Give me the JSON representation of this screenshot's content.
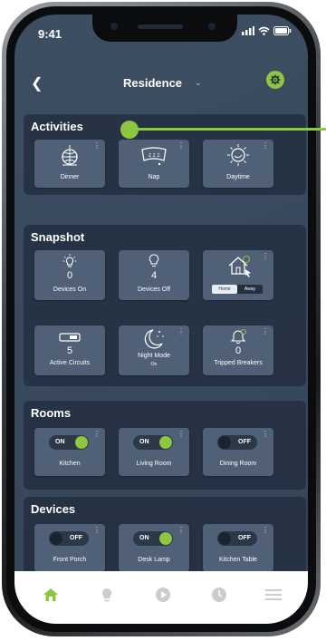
{
  "status": {
    "time": "9:41"
  },
  "header": {
    "title": "Residence"
  },
  "colors": {
    "accent": "#8dc63f",
    "card": "#4f6077",
    "section": "#232f40"
  },
  "activities": {
    "title": "Activities",
    "items": [
      {
        "label": "Dinner",
        "icon": "disco-ball-icon"
      },
      {
        "label": "Nap",
        "icon": "pillow-icon"
      },
      {
        "label": "Daytime",
        "icon": "sun-icon"
      }
    ]
  },
  "snapshot": {
    "title": "Snapshot",
    "devices_on": {
      "value": "0",
      "label": "Devices On"
    },
    "devices_off": {
      "value": "4",
      "label": "Devices Off"
    },
    "home_away": {
      "home": "Home",
      "away": "Away",
      "selected": "Home"
    },
    "active_circuits": {
      "value": "5",
      "label": "Active Circuits"
    },
    "night_mode": {
      "label": "Night Mode",
      "sub": "On"
    },
    "tripped_breakers": {
      "value": "0",
      "label": "Tripped Breakers"
    }
  },
  "rooms": {
    "title": "Rooms",
    "items": [
      {
        "label": "Kitchen",
        "state": "ON"
      },
      {
        "label": "Living Room",
        "state": "ON"
      },
      {
        "label": "Dining Room",
        "state": "OFF"
      }
    ]
  },
  "devices": {
    "title": "Devices",
    "items": [
      {
        "label": "Front Porch",
        "state": "OFF"
      },
      {
        "label": "Desk Lamp",
        "state": "ON"
      },
      {
        "label": "Kitchen Table",
        "state": "OFF"
      }
    ]
  },
  "tabs": [
    "home-icon",
    "bulb-icon",
    "play-icon",
    "clock-icon",
    "menu-icon"
  ]
}
